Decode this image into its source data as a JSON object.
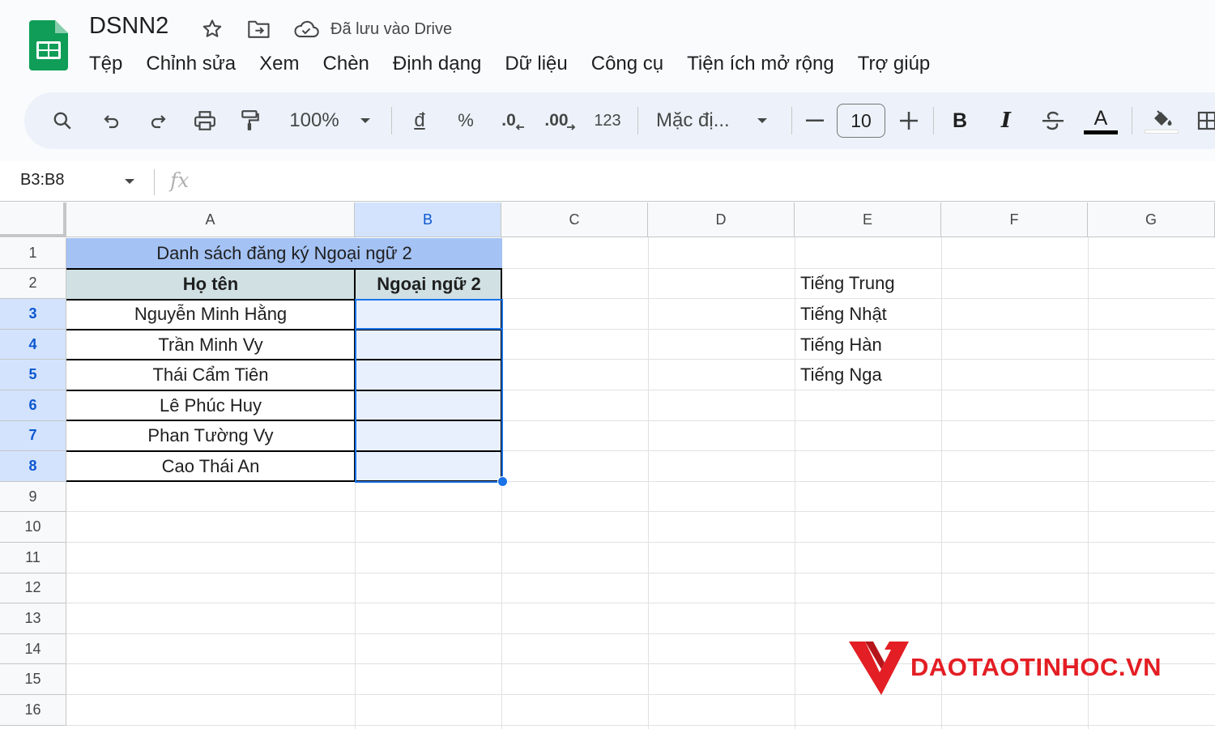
{
  "header": {
    "doc_title": "DSNN2",
    "saved_status": "Đã lưu vào Drive",
    "menu": [
      "Tệp",
      "Chỉnh sửa",
      "Xem",
      "Chèn",
      "Định dạng",
      "Dữ liệu",
      "Công cụ",
      "Tiện ích mở rộng",
      "Trợ giúp"
    ]
  },
  "toolbar": {
    "zoom": "100%",
    "currency_label": "đ",
    "percent_label": "%",
    "decrease_decimal_label": ".0",
    "increase_decimal_label": ".00",
    "number_format_label": "123",
    "font_name": "Mặc đị...",
    "font_size": "10",
    "bold_label": "B",
    "italic_label": "I",
    "text_color_label": "A",
    "colors": {
      "text_color_bar": "#000000",
      "fill_color_bar": "#ffffff"
    }
  },
  "formula_bar": {
    "name_box": "B3:B8",
    "fx_label": "fx"
  },
  "sheet": {
    "columns": [
      "A",
      "B",
      "C",
      "D",
      "E",
      "F",
      "G"
    ],
    "rows": [
      "1",
      "2",
      "3",
      "4",
      "5",
      "6",
      "7",
      "8",
      "9",
      "10",
      "11",
      "12",
      "13",
      "14",
      "15",
      "16"
    ],
    "table_title": "Danh sách đăng ký Ngoại ngữ 2",
    "header_name": "Họ tên",
    "header_language": "Ngoại ngữ 2",
    "names": [
      "Nguyễn Minh Hằng",
      "Trần Minh Vy",
      "Thái Cẩm Tiên",
      "Lê Phúc Huy",
      "Phan Tường Vy",
      "Cao Thái An"
    ],
    "languages": [
      "Tiếng Trung",
      "Tiếng Nhật",
      "Tiếng Hàn",
      "Tiếng Nga"
    ],
    "selected_range": "B3:B8",
    "colors": {
      "title_fill": "#a4c2f4",
      "header_fill": "#d0e0e3",
      "selection": "#1a73e8"
    }
  },
  "watermark": {
    "text": "DAOTAOTINHOC.VN",
    "color": "#e31e24"
  }
}
